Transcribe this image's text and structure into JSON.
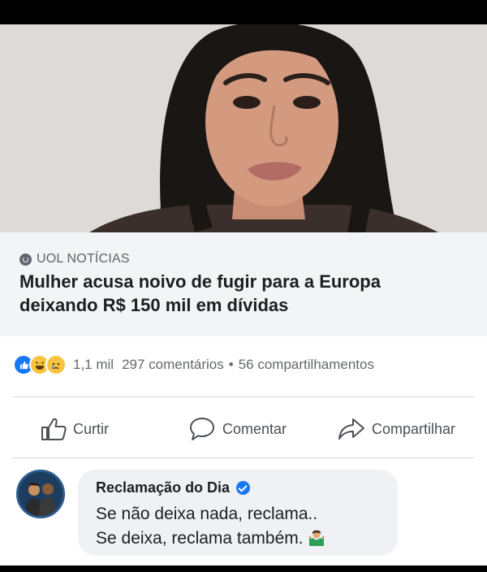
{
  "post": {
    "source_label": "UOL NOTÍCIAS",
    "headline_line1": "Mulher acusa noivo de fugir para a Europa",
    "headline_line2": "deixando R$ 150 mil em dívidas"
  },
  "stats": {
    "reactions": [
      "like",
      "haha",
      "sad"
    ],
    "reaction_count": "1,1 mil",
    "comments": "297 comentários",
    "separator": "•",
    "shares": "56 compartilhamentos"
  },
  "actions": {
    "like_label": "Curtir",
    "comment_label": "Comentar",
    "share_label": "Compartilhar"
  },
  "comment": {
    "author": "Reclamação do Dia",
    "line1": "Se não deixa nada, reclama..",
    "line2": "Se deixa, reclama também."
  },
  "colors": {
    "facebook_blue": "#1877f2",
    "background": "#ffffff",
    "link_box": "#f3f4f6"
  }
}
